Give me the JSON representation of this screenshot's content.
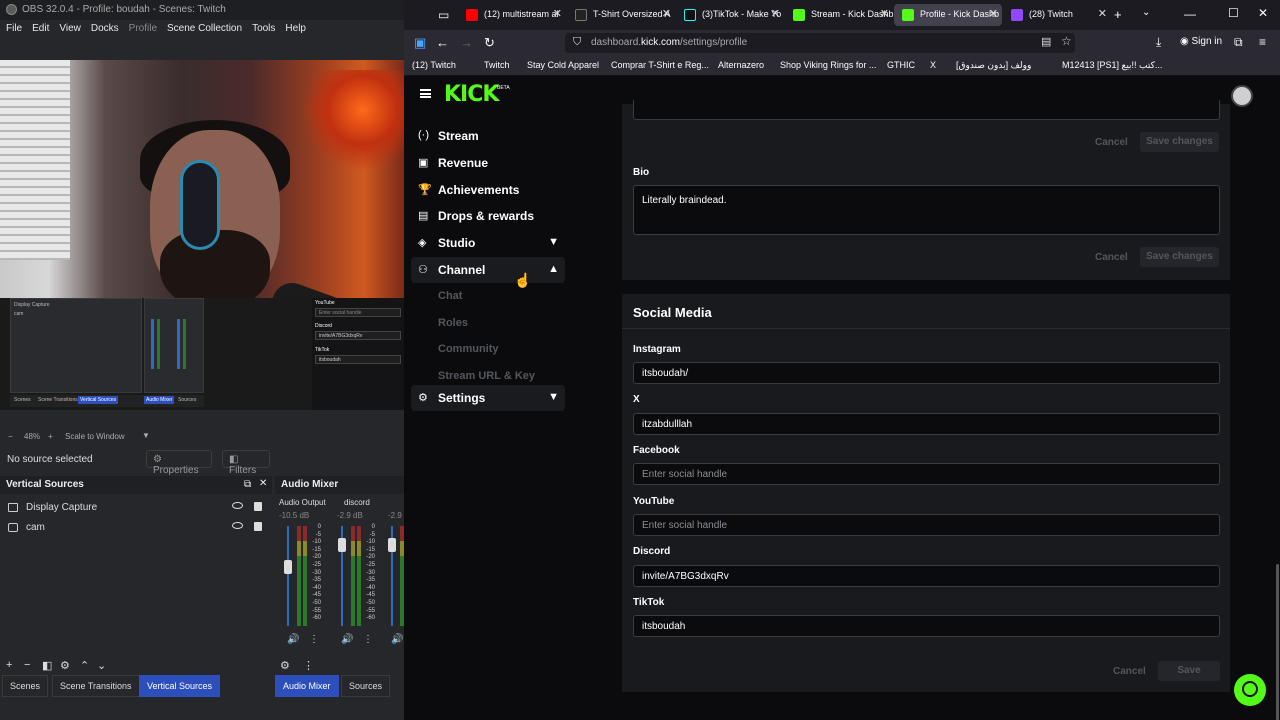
{
  "obs": {
    "title": "OBS 32.0.4 - Profile: boudah - Scenes: Twitch",
    "menu": [
      "File",
      "Edit",
      "View",
      "Docks",
      "Profile",
      "Scene Collection",
      "Tools",
      "Help"
    ],
    "zoom": "48%",
    "scale_mode": "Scale to Window",
    "no_source": "No source selected",
    "properties": "Properties",
    "filters": "Filters",
    "vertical_sources": {
      "title": "Vertical Sources",
      "items": [
        {
          "name": "Display Capture",
          "icon": "monitor-icon"
        },
        {
          "name": "cam",
          "icon": "camera-icon"
        }
      ]
    },
    "audio_mixer": {
      "title": "Audio Mixer",
      "channels": [
        {
          "name": "Audio Output",
          "db": "-10.5 dB"
        },
        {
          "name": "discord",
          "db": "-2.9 dB"
        },
        {
          "name": "",
          "db": "-2.9"
        }
      ],
      "scale": [
        "0",
        "-5",
        "-10",
        "-15",
        "-20",
        "-25",
        "-30",
        "-35",
        "-40",
        "-45",
        "-50",
        "-55",
        "-60"
      ]
    },
    "bottom_tabs_left": [
      "Scenes",
      "Scene Transitions",
      "Vertical Sources"
    ],
    "bottom_tabs_right": [
      "Audio Mixer",
      "Sources"
    ],
    "preview_mini": {
      "sources": [
        "Display Capture",
        "cam"
      ],
      "social_labels": [
        "YouTube",
        "Discord",
        "TikTok"
      ],
      "social_values": [
        "Enter social handle",
        "invite/A7BG3dxqRv",
        "itsboudah"
      ],
      "tabs": [
        "Scenes",
        "Scene Transitions",
        "Vertical Sources",
        "Audio Mixer",
        "Sources"
      ]
    }
  },
  "browser": {
    "tabs": [
      {
        "title": "(12) multistream al",
        "color": "#ff0000",
        "active": false
      },
      {
        "title": "T-Shirt Oversized A",
        "color": "#222222",
        "active": false
      },
      {
        "title": "(3)TikTok - Make Yo",
        "color": "#111111",
        "active": false
      },
      {
        "title": "Stream - Kick Dashb",
        "color": "#53fc18",
        "active": false
      },
      {
        "title": "Profile - Kick Dashb",
        "color": "#53fc18",
        "active": true
      },
      {
        "title": "(28) Twitch",
        "color": "#9146ff",
        "active": false
      }
    ],
    "url_prefix": "dashboard.",
    "url_domain": "kick.com",
    "url_path": "/settings/profile",
    "sign_in": "Sign in",
    "bookmarks": [
      "(12) Twitch",
      "Twitch",
      "Stay Cold Apparel",
      "Comprar T-Shirt e Reg...",
      "Alternazero",
      "Shop Viking Rings for ...",
      "GTHIC",
      "X",
      "وولف [بدون صندوق]",
      "M12413 [PS1] كتب !!بيع..."
    ]
  },
  "kick": {
    "logo": "KICK",
    "logo_badge": "BETA",
    "sidebar": [
      {
        "label": "Stream",
        "icon": "(·)"
      },
      {
        "label": "Revenue",
        "icon": "▣"
      },
      {
        "label": "Achievements",
        "icon": "🏆"
      },
      {
        "label": "Drops & rewards",
        "icon": "▤"
      },
      {
        "label": "Studio",
        "icon": "◈"
      },
      {
        "label": "Channel",
        "icon": "⚇"
      },
      {
        "label": "Settings",
        "icon": "⚙"
      }
    ],
    "channel_sub": [
      "Chat",
      "Roles",
      "Community",
      "Stream URL & Key"
    ],
    "cancel": "Cancel",
    "save_changes": "Save changes",
    "save": "Save",
    "bio_label": "Bio",
    "bio_value": "Literally braindead.",
    "social_title": "Social Media",
    "socials": [
      {
        "label": "Instagram",
        "value": "itsboudah/",
        "placeholder": false
      },
      {
        "label": "X",
        "value": "itzabdulllah",
        "placeholder": false
      },
      {
        "label": "Facebook",
        "value": "Enter social handle",
        "placeholder": true
      },
      {
        "label": "YouTube",
        "value": "Enter social handle",
        "placeholder": true
      },
      {
        "label": "Discord",
        "value": "invite/A7BG3dxqRv",
        "placeholder": false
      },
      {
        "label": "TikTok",
        "value": "itsboudah",
        "placeholder": false
      }
    ]
  }
}
